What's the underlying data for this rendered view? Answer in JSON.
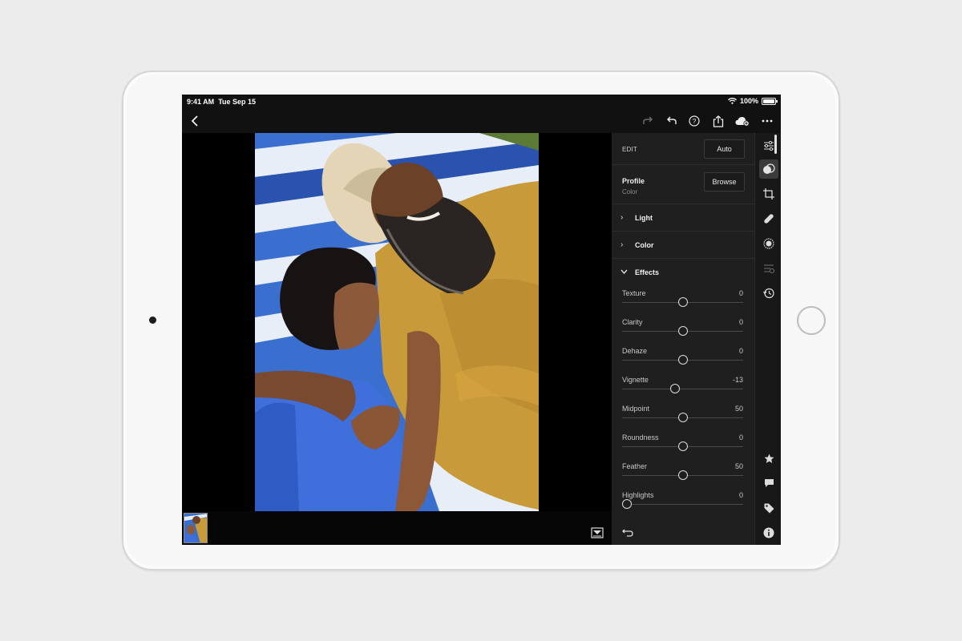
{
  "status": {
    "time": "9:41 AM",
    "date": "Tue Sep 15",
    "battery": "100%"
  },
  "edit": {
    "header": "EDIT",
    "auto_label": "Auto",
    "profile_title": "Profile",
    "profile_value": "Color",
    "browse_label": "Browse",
    "sections": [
      {
        "label": "Light",
        "expanded": false
      },
      {
        "label": "Color",
        "expanded": false
      },
      {
        "label": "Effects",
        "expanded": true
      }
    ],
    "sliders": [
      {
        "name": "Texture",
        "value": "0",
        "level": 0.5
      },
      {
        "name": "Clarity",
        "value": "0",
        "level": 0.5
      },
      {
        "name": "Dehaze",
        "value": "0",
        "level": 0.5
      },
      {
        "name": "Vignette",
        "value": "-13",
        "level": 0.44
      },
      {
        "name": "Midpoint",
        "value": "50",
        "level": 0.5
      },
      {
        "name": "Roundness",
        "value": "0",
        "level": 0.5
      },
      {
        "name": "Feather",
        "value": "50",
        "level": 0.5
      },
      {
        "name": "Highlights",
        "value": "0",
        "level": 0.04
      }
    ]
  },
  "toolbar_icons": [
    "back-icon",
    "redo-icon",
    "undo-icon",
    "help-icon",
    "share-icon",
    "cloud-sync-icon",
    "more-icon"
  ],
  "tools": [
    "edit-sliders-icon",
    "masking-icon",
    "crop-icon",
    "healing-icon",
    "selective-icon",
    "presets-icon",
    "history-icon",
    "star-icon",
    "comment-icon",
    "tag-icon",
    "info-icon"
  ],
  "colors": {
    "panel": "#1f1f1f",
    "toolstrip": "#181818",
    "accent_active": "#3b3b3b"
  }
}
